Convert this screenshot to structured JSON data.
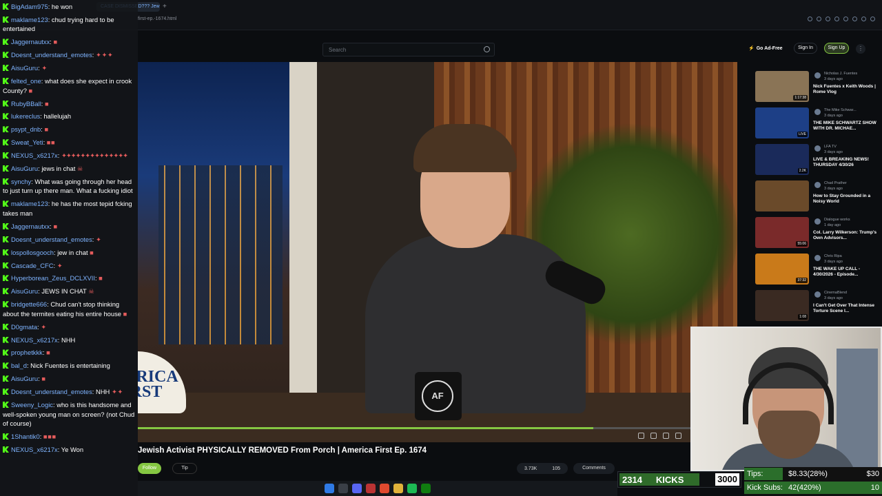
{
  "browser": {
    "tab_label": "CASE DISMISSED??? Jewi",
    "tab_new": "+",
    "url_fragment": "first-ep.-1674.html"
  },
  "header": {
    "search_placeholder": "Search",
    "go_adfree": "Go Ad-Free",
    "sign_in": "Sign In",
    "sign_up": "Sign Up",
    "menu": "⋮"
  },
  "video": {
    "title": "Jewish Activist PHYSICALLY REMOVED From Porch | America First Ep. 1674",
    "mug_logo": "AF",
    "hat_text": "AMERICA FIRST",
    "progress": 0.76
  },
  "actions": {
    "follow": "Follow",
    "tip": "Tip",
    "likes": "3.73K",
    "dislikes": "105",
    "comments": "Comments"
  },
  "sidebar": {
    "items": [
      {
        "channel": "Nicholas J. Fuentes",
        "time": "3 days ago",
        "title": "Nick Fuentes x Keith Woods | Rome Vlog",
        "duration": "1:17:38",
        "color": "#8a7456"
      },
      {
        "channel": "The Mike Schwar...",
        "time": "3 days ago",
        "title": "THE MIKE SCHWARTZ SHOW WITH DR. MICHAE...",
        "duration": "LIVE",
        "color": "#1d3f86"
      },
      {
        "channel": "LFA TV",
        "time": "3 days ago",
        "title": "LIVE & BREAKING NEWS! THURSDAY 4/30/26",
        "duration": "2.2K",
        "color": "#1a2a5a"
      },
      {
        "channel": "Chad Prather",
        "time": "3 days ago",
        "title": "How to Stay Grounded in a Noisy World",
        "duration": "",
        "color": "#6a4a2a"
      },
      {
        "channel": "Dialogue works",
        "time": "1 day ago",
        "title": "Col. Larry Wilkerson: Trump's Own Advisors...",
        "duration": "55:06",
        "color": "#7a2a2a"
      },
      {
        "channel": "Chris Ripa",
        "time": "3 days ago",
        "title": "THE WAKE UP CALL - 4/30/2026 - Episode...",
        "duration": "37:32",
        "color": "#c97a1a"
      },
      {
        "channel": "CinemaBlend",
        "time": "3 days ago",
        "title": "I Can't Get Over That Intense Torture Scene I...",
        "duration": "1:08",
        "color": "#3a2a22"
      }
    ]
  },
  "overlay": {
    "kicks_count": "2314",
    "kicks_label": "KICKS",
    "kicks_goal": "3000",
    "kicks_fraction": 0.77,
    "tips_label": "Tips:",
    "tips_value": "$8.33(28%)",
    "tips_target": "$30",
    "tips_fraction": 0.28,
    "subs_label": "Kick Subs:",
    "subs_value": "42(420%)",
    "subs_target": "10",
    "subs_fraction": 1.0
  },
  "chat": [
    {
      "user": "BigAdam975",
      "text": "he won",
      "emotes": ""
    },
    {
      "user": "maklame123",
      "text": "chud trying hard to be entertained",
      "emotes": ""
    },
    {
      "user": "Jaggernautxx",
      "text": "",
      "emotes": "■"
    },
    {
      "user": "Doesnt_understand_emotes",
      "text": "",
      "emotes": "✦ ✦ ✦"
    },
    {
      "user": "AisuGuru",
      "text": "",
      "emotes": "✦"
    },
    {
      "user": "felted_one",
      "text": "what does she expect in crook County?",
      "emotes": "■"
    },
    {
      "user": "RubyBBall",
      "text": "",
      "emotes": "■"
    },
    {
      "user": "lukereclus",
      "text": "hallelujah",
      "emotes": ""
    },
    {
      "user": "psypt_dnb",
      "text": "",
      "emotes": "■"
    },
    {
      "user": "Sweat_Yeti",
      "text": "",
      "emotes": "■ ■"
    },
    {
      "user": "NEXUS_x6217x",
      "text": "",
      "emotes": "✦✦✦✦✦✦✦✦✦✦✦✦✦✦"
    },
    {
      "user": "AisuGuru",
      "text": "jews in chat",
      "emotes": "☠"
    },
    {
      "user": "synchy",
      "text": "What was going through her head to just turn up there man. What a fucking idiot",
      "emotes": ""
    },
    {
      "user": "maklame123",
      "text": "he has the most tepid fcking takes man",
      "emotes": ""
    },
    {
      "user": "Jaggernautxx",
      "text": "",
      "emotes": "■"
    },
    {
      "user": "Doesnt_understand_emotes",
      "text": "",
      "emotes": "✦"
    },
    {
      "user": "lospollosgooch",
      "text": "jew in chat",
      "emotes": "■"
    },
    {
      "user": "Cascade_CFC",
      "text": "",
      "emotes": "✦"
    },
    {
      "user": "Hyperborean_Zeus_DCLXVII",
      "text": "",
      "emotes": "■"
    },
    {
      "user": "AisuGuru",
      "text": "JEWS IN CHAT",
      "emotes": "☠"
    },
    {
      "user": "bridgette666",
      "text": "Chud can't stop thinking about the termites eating his entire house",
      "emotes": "■"
    },
    {
      "user": "D0gmata",
      "text": "",
      "emotes": "✦"
    },
    {
      "user": "NEXUS_x6217x",
      "text": "NHH",
      "emotes": ""
    },
    {
      "user": "prophetkkk",
      "text": "",
      "emotes": "■"
    },
    {
      "user": "bal_d",
      "text": "Nick Fuentes is entertaining",
      "emotes": ""
    },
    {
      "user": "AisuGuru",
      "text": "",
      "emotes": "■"
    },
    {
      "user": "Doesnt_understand_emotes",
      "text": "NHH",
      "emotes": "✦ ✦"
    },
    {
      "user": "Sweeny_Logic",
      "text": "who is this handsome and well-spoken young man on screen? (not Chud of course)",
      "emotes": ""
    },
    {
      "user": "1Shantik0",
      "text": "",
      "emotes": "■ ■ ■"
    },
    {
      "user": "NEXUS_x6217x",
      "text": "Ye Won",
      "emotes": ""
    }
  ]
}
